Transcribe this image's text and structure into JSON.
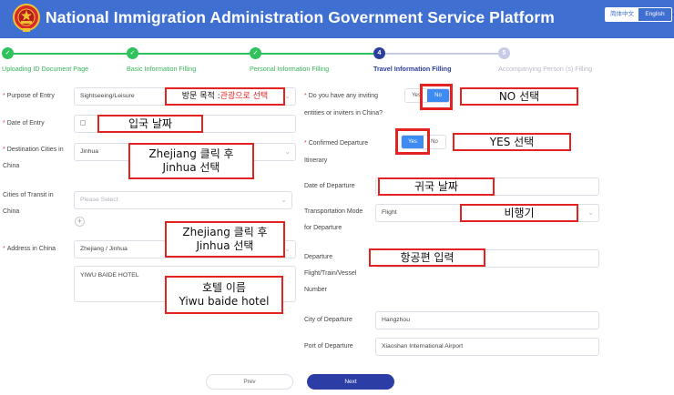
{
  "header": {
    "title": "National Immigration Administration Government Service Platform",
    "lang_cn": "简体中文",
    "lang_en": "English"
  },
  "steps": [
    {
      "num": "✓",
      "label": "Uploading ID Document Page",
      "state": "done"
    },
    {
      "num": "✓",
      "label": "Basic Information Filling",
      "state": "done"
    },
    {
      "num": "✓",
      "label": "Personal Information Filling",
      "state": "done"
    },
    {
      "num": "4",
      "label": "Travel Information Filling",
      "state": "active"
    },
    {
      "num": "5",
      "label": "Accompanying Person (s) Filling",
      "state": "todo"
    }
  ],
  "left": {
    "purpose_label": "Purpose of Entry",
    "purpose_value": "Sightseeing/Leisure",
    "date_entry_label": "Date of Entry",
    "dest_label_1": "Destination Cities in",
    "dest_label_2": "China",
    "dest_value": "Jinhua",
    "transit_label_1": "Cities of Transit in",
    "transit_label_2": "China",
    "transit_placeholder": "Please Select",
    "address_label": "Address in China",
    "address_value": "Zhejiang / Jinhua",
    "address_detail": "YIWU BAIDE HOTEL"
  },
  "right": {
    "inviting_label_1": "Do you have any inviting",
    "inviting_label_2": "entities or inviters in China?",
    "yes": "Yes",
    "no": "No",
    "confirmed_label_1": "Confirmed Departure",
    "confirmed_label_2": "Itinerary",
    "date_departure_label": "Date of Departure",
    "transport_label_1": "Transportation Mode",
    "transport_label_2": "for Departure",
    "transport_value": "Flight",
    "departure_label_1": "Departure",
    "departure_label_2": "Flight/Train/Vessel",
    "departure_label_3": "Number",
    "city_departure_label": "City of Departure",
    "city_departure_value": "Hangzhou",
    "port_departure_label": "Port of Departure",
    "port_departure_value": "Xiaoshan International Airport"
  },
  "buttons": {
    "prev": "Prev",
    "next": "Next"
  },
  "annotations": {
    "purpose_prefix": "방문 목적 : ",
    "purpose_red": "관광으로 선택",
    "entry_date": "입국 날짜",
    "dest_1": "Zhejiang 클릭 후",
    "dest_2": "Jinhua 선택",
    "addr_1": "Zhejiang 클릭 후",
    "addr_2": "Jinhua 선택",
    "hotel_1": "호텔 이름",
    "hotel_2": "Yiwu baide hotel",
    "no_select": "NO 선택",
    "yes_select": "YES 선택",
    "return_date": "귀국 날짜",
    "airplane": "비행기",
    "flight_input": "항공편 입력"
  },
  "colors": {
    "header_bg": "#3f6fd0",
    "step_done": "#30c25c",
    "step_active": "#2c3e9c",
    "toggle_on": "#3e8cf2",
    "annotation_red": "#e32222"
  }
}
